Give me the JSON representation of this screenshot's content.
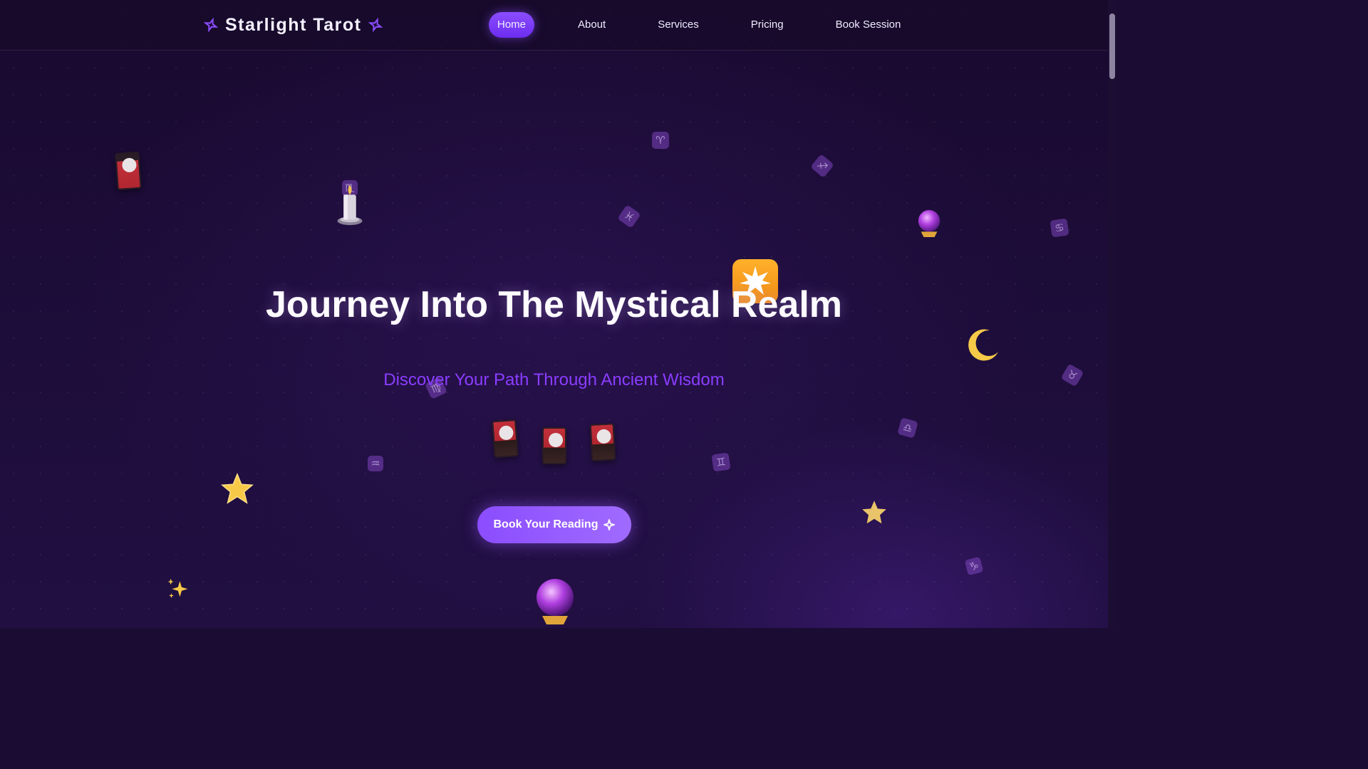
{
  "nav": {
    "brand": "Starlight Tarot",
    "links": [
      {
        "label": "Home",
        "active": true
      },
      {
        "label": "About",
        "active": false
      },
      {
        "label": "Services",
        "active": false
      },
      {
        "label": "Pricing",
        "active": false
      },
      {
        "label": "Book Session",
        "active": false
      }
    ]
  },
  "hero": {
    "title": "Journey Into The Mystical Realm",
    "subtitle": "Discover Your Path Through Ancient Wisdom",
    "cta_label": "Book Your Reading"
  },
  "decorations": {
    "zodiac_symbols": [
      "♈",
      "♐",
      "♓",
      "♋",
      "♉",
      "♍",
      "♎",
      "♊",
      "♒",
      "♑",
      "♏"
    ],
    "icons": [
      "tarot-card-icon",
      "candle-icon",
      "crystal-ball-icon",
      "eight-pointed-star-icon",
      "crescent-moon-icon",
      "glowing-star-icon",
      "star-icon",
      "sparkles-icon"
    ]
  },
  "colors": {
    "accent": "#8b4dff",
    "subtitle": "#8a3dff",
    "background": "#1a0c33"
  }
}
